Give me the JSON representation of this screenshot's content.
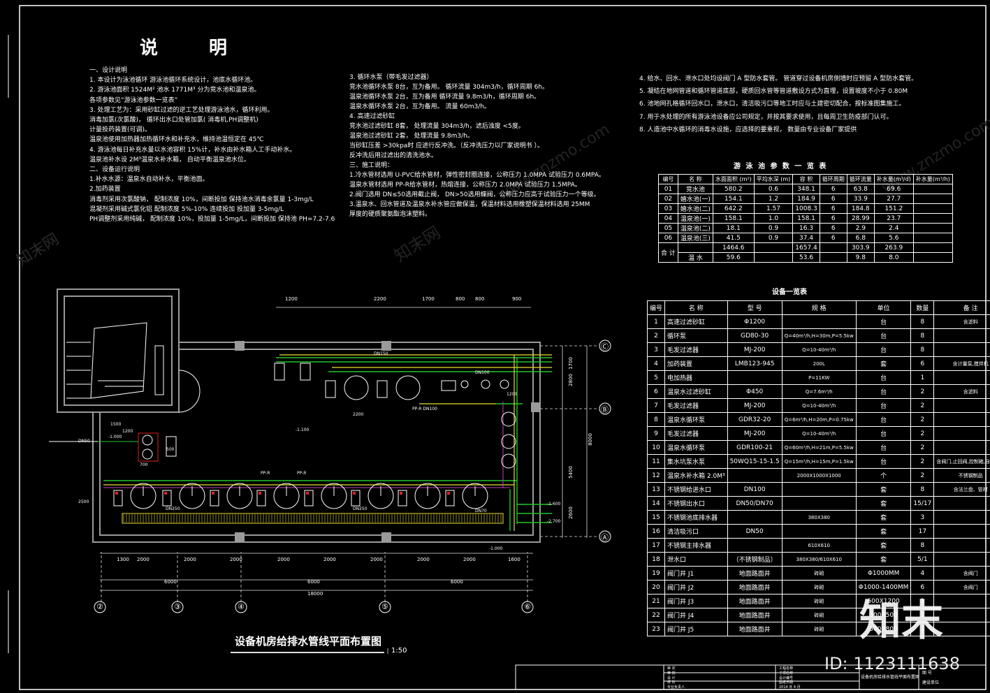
{
  "title": "说    明",
  "notes_col1": [
    "一、设计说明",
    "1.    本设计为泳池循环                 游泳池循环系统设计，池底水循环池。",
    "2.    游泳池面积       1524M²  池水       1771M³ 分为竞水池和温泉池。",
    "       各项参数见“游泳池参数一览表”",
    "3.    处理工艺为：采用砂缸过滤的逆工艺处理游泳池水，循环利用。",
    "       消毒加氯(次氯酸)，  循环出水口处管加氯( 消毒机,PH调整机)",
    "       计量投药装置(可调)。",
    "       温泉池使用加热器加热循环水和补充水，维持池温恒定在         45℃",
    "4.    游泳池每日补充水量以水池容积            15%计，补水由补水箱人工手动补水。",
    "       温泉池补水设         2M³温泉水补水箱，      自动平衡温泉池水位。",
    "二、设备运行说明",
    "1.补水水源：温泉水自动补水，平衡池面。",
    "2.加药装置",
    "   消毒剂采用次氯酸钠，   配制浓度   10%，间断投加      保持池水消毒余氯量              1-3mg/L",
    "   混凝剂采用碱式氯化铝    配制浓度  5%-10%  连续投加    投加量  3-5mg/L",
    "PH调整剂采用纯碱，       配制浓度  10%，投加量  1-5mg/L，间断投加    保持池        PH=7.2-7.6"
  ],
  "notes_col2": [
    "3.    循环水泵（带毛发过滤器）",
    "       竞水池循环水泵         8台，互为备用。      循环流量  304m3/h，循环周期      6h。",
    "       温泉池循环水泵         2台，互为备用      循环流量  9.8m3/h，循环周期      6h。",
    "       温泉水循环水泵         2台，互为备用。   流量  60m3/h。",
    "4.    高速过滤砂缸",
    "       竞水池过滤砂缸        8套，      处理流量  304m3/h，滤后浊度     <5度。",
    "       温泉池过滤砂缸        2套，      处理流量  9.8m3/h。",
    "       当砂缸压差         >30kpa时      应进行反冲洗。（反冲洗压力以厂家说明书               ）。",
    "       反冲洗后用过滤出的清洗池水。",
    "三、施工说明：",
    "1.冷水管材选用       U-PVC给水管材，弹性密封圈连接，公称压力              1.0MPA 试验压力      0.6MPA。",
    "   温泉水管材选用         PP-R给水管材，热熔连接，公称压力              2.0MPA 试验压力      1.5MPA。",
    "2.阀门选用   DN≤50选用截止阀，   DN>50选用蝶阀，公称压力应高于试验压力一个等级。",
    "3.温泉水、回水管道及温泉水补水管应做保温，保温材料选用橡塑保温材料选用                       25MM",
    "   厚度的硬质聚氨酯泡沫塑料。"
  ],
  "notes_col3": [
    "4.   给水、回水、泄水口处均设阀门                 A 型防水套管。  管道穿过设备机房侧墙时应预留                      A 型防水套管。",
    "5.   凝结在地网管道和循环管道底部，硬质回水管等管道敷设方式为直埋，设置坡度不小于                           0.80M",
    "6.   池地网孔格循环回水口，泄水口，清洁吸污口等地工时应与土建密切配合，按标准图集施工。",
    "7.   用于水处理的所有游泳池设备应公司规定，并按其要求使用，且每周卫生防疫部门认可。",
    "8.   人造池中水循环的消毒水设施，应选择的要重视，    数量由专业设备厂家提供"
  ],
  "pool_table": {
    "title": "游 泳 池 参 数 一 览 表",
    "headers": [
      "编号",
      "名    称",
      "水面面积 (m²)",
      "平均水深 (m)",
      "容  积",
      "循环周期",
      "循环流量",
      "补水量(m³/d)",
      "补水量(m³/h)"
    ],
    "rows": [
      [
        "01",
        "竞水池",
        "580.2",
        "0.6",
        "348.1",
        "6",
        "63.8",
        "69.6"
      ],
      [
        "02",
        "嬉水池(一)",
        "154.1",
        "1.2",
        "184.9",
        "6",
        "33.9",
        "27.7"
      ],
      [
        "03",
        "嬉水池(二)",
        "642.2",
        "1.57",
        "1008.3",
        "6",
        "184.8",
        "151.2"
      ],
      [
        "04",
        "温泉池(一)",
        "158.1",
        "1.0",
        "158.1",
        "6",
        "28.99",
        "23.7"
      ],
      [
        "05",
        "温泉池(二)",
        "18.1",
        "0.9",
        "16.3",
        "6",
        "2.9",
        "2.4"
      ],
      [
        "06",
        "温泉池(三)",
        "41.5",
        "0.9",
        "37.4",
        "6",
        "6.8",
        "5.6"
      ]
    ],
    "total_label": "合 计",
    "total_row1": [
      "1464.6",
      "1657.4",
      "303.9",
      "263.9"
    ],
    "total_label2": "温 水",
    "total_row2": [
      "59.6",
      "53.6",
      "9.8",
      "8.0"
    ]
  },
  "equip_table": {
    "title": "设备一览表",
    "headers": [
      "编号",
      "名    称",
      "型    号",
      "规    格",
      "单位",
      "数量",
      "备    注"
    ],
    "rows": [
      [
        "1",
        "高速过滤砂缸",
        "Φ1200",
        "",
        "台",
        "8",
        "含滤料"
      ],
      [
        "2",
        "循环泵",
        "GD80-30",
        "Q=40m³/h,H=30m,P=5.5kw",
        "台",
        "8",
        ""
      ],
      [
        "3",
        "毛发过滤器",
        "MJ-200",
        "Q=10-40m³/h",
        "台",
        "8",
        ""
      ],
      [
        "4",
        "加药装置",
        "LMB123-945",
        "200L",
        "套",
        "6",
        "含计量泵,搅拌机"
      ],
      [
        "5",
        "电加热器",
        "",
        "P=11KW",
        "台",
        "1",
        ""
      ],
      [
        "6",
        "温泉水过滤砂缸",
        "Φ450",
        "Q=7.6m³/h",
        "台",
        "2",
        "含滤料"
      ],
      [
        "7",
        "毛发过滤器",
        "MJ-200",
        "Q=10-40m³/h",
        "台",
        "2",
        ""
      ],
      [
        "8",
        "温泉水循环泵",
        "GDR32-20",
        "Q=6m³/h,H=20m,P=0.75kw",
        "台",
        "2",
        ""
      ],
      [
        "9",
        "毛发过滤器",
        "MJ-200",
        "Q=10-40m³/h",
        "台",
        "2",
        ""
      ],
      [
        "10",
        "温泉水循环泵",
        "GDR100-21",
        "Q=60m³/h,H=21m,P=5.5kw",
        "台",
        "2",
        ""
      ],
      [
        "11",
        "集水坑泵水泵",
        "50WQ15-15-1.5",
        "Q=15m³/h,H=15m,P=1.5kw",
        "台",
        "2",
        "含阀门,止回阀,控制箱,自耦装置"
      ],
      [
        "12",
        "温泉水补水箱  2.0M³",
        "",
        "2000X1000X1000",
        "个",
        "2",
        "不锈钢制品"
      ],
      [
        "13",
        "不锈钢给进水口",
        "DN100",
        "",
        "套",
        "8",
        "含法兰盘、管材"
      ],
      [
        "14",
        "不锈钢出水口",
        "DN50/DN70",
        "",
        "套",
        "15/17",
        ""
      ],
      [
        "15",
        "不锈钢池底排水器",
        "",
        "380X380",
        "套",
        "3",
        ""
      ],
      [
        "16",
        "清洁吸污口",
        "DN50",
        "",
        "套",
        "17",
        ""
      ],
      [
        "17",
        "不锈钢主排水器",
        "",
        "610X610",
        "套",
        "8",
        ""
      ],
      [
        "18",
        "泄水口",
        "（不锈钢制品）",
        "380X380/610X610",
        "套",
        "5/1",
        ""
      ],
      [
        "19",
        "阀门井     J1",
        "地面路面井",
        "砖砌",
        "Φ1000MM",
        "4",
        "含阀门"
      ],
      [
        "20",
        "阀门井     J2",
        "地面路面井",
        "砖砌",
        "Φ1000-1400MM",
        "6",
        "含阀门"
      ],
      [
        "21",
        "阀门井     J3",
        "地面路面井",
        "砖砌",
        "500X1200",
        "1",
        ""
      ],
      [
        "22",
        "阀门井     J4",
        "地面路面井",
        "砖砌",
        "300X500",
        "1",
        ""
      ],
      [
        "23",
        "阀门井     J5",
        "地面路面井",
        "砖砌",
        "500X800",
        "1",
        ""
      ]
    ]
  },
  "plan": {
    "title": "设备机房给排水管线平面布置图",
    "scale": "1:50",
    "top_dims": [
      "1200",
      "2200",
      "1700",
      "800",
      "800",
      "900"
    ],
    "bottom_dims": [
      "1300",
      "2000",
      "2000",
      "2000",
      "2000",
      "2000",
      "2000",
      "2000",
      "2000",
      "1600"
    ],
    "bay_dims": [
      "6000",
      "6000",
      "6000"
    ],
    "total_dim": "18000",
    "right_dims": [
      "1700",
      "2800",
      "8000",
      "5400",
      "2600"
    ],
    "axes_v": [
      "②",
      "③",
      "④",
      "⑤",
      "⑥"
    ],
    "axes_h": [
      "Ⓒ",
      "Ⓑ",
      "Ⓐ"
    ],
    "labels": {
      "dn150": "DN150",
      "dn100": "DN100",
      "dn50": "DN50",
      "ppr1": "PP-R  DN100",
      "ppr2": "PP-R",
      "ppr3": "PP-R",
      "d2200": "2200",
      "d1200": "1200",
      "d1500": "1500",
      "d1200b": "1200",
      "d700": "700",
      "d500": "500",
      "d2500": "2500",
      "elev1": "-1.000",
      "elev2": "-1.600",
      "elev3": "-2.700",
      "elev4": "-1.000",
      "elev5": "-1.100",
      "dnv1": "DN250",
      "dnv2": "DN250",
      "dn70": "DN70"
    }
  },
  "title_block": {
    "rows": [
      "审 定",
      "审 核",
      "设 计",
      "校 对",
      "专业负责人"
    ],
    "fields": [
      "工程名称",
      "子项名称",
      "设计编号",
      "图纸日期",
      "2014 年 4 月"
    ],
    "drawing_name": "设备机房给排水管线平面布置图",
    "sheet_no": "图 号",
    "company": "建设单位"
  },
  "watermark": {
    "brand": "知末",
    "id": "ID: 1123111638",
    "site": "www.znzmo.com",
    "site_cn": "知末网"
  },
  "colors": {
    "bg": "#000000",
    "line": "#ffffff",
    "wall": "#9a9a9a",
    "pipe_green": "#22c52b",
    "pipe_yellow": "#e8e030",
    "pipe_red": "#e02020",
    "pipe_magenta": "#c040c0",
    "dim": "#e0e0e0"
  }
}
